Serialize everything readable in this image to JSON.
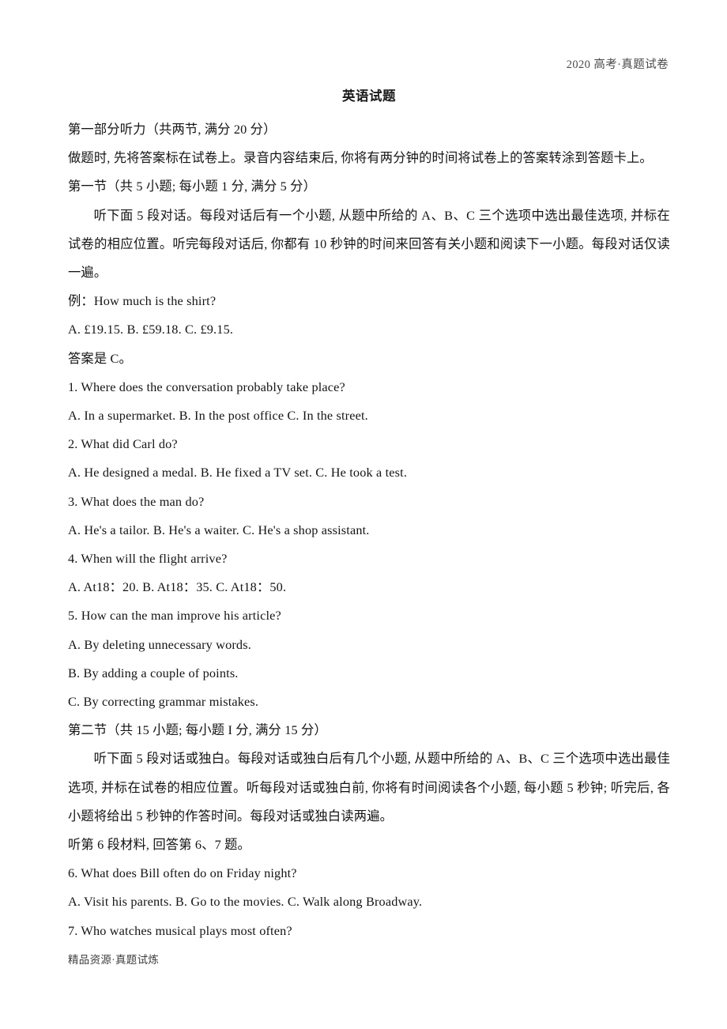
{
  "header": {
    "running_head": "2020 高考·真题试卷"
  },
  "paper": {
    "title": "英语试题"
  },
  "section_one": {
    "heading": "第一部分听力（共两节, 满分 20 分）",
    "instruction": "做题时, 先将答案标在试卷上。录音内容结束后, 你将有两分钟的时间将试卷上的答案转涂到答题卡上。",
    "part_one_heading": "第一节（共 5 小题; 每小题 1 分, 满分 5 分）",
    "part_one_directions": "听下面 5 段对话。每段对话后有一个小题, 从题中所给的 A、B、C 三个选项中选出最佳选项, 并标在试卷的相应位置。听完每段对话后, 你都有 10 秒钟的时间来回答有关小题和阅读下一小题。每段对话仅读一遍。",
    "example": {
      "stem": "例：How much is the shirt?",
      "options": "A. £19.15.        B. £59.18.        C. £9.15.",
      "answer": "答案是 C。"
    },
    "questions": [
      {
        "stem": "1. Where does the conversation probably take place?",
        "options": "A. In a supermarket.        B. In the post office        C. In the street."
      },
      {
        "stem": "2. What did Carl do?",
        "options": "A. He designed a medal.        B. He fixed a TV set.        C. He took a test."
      },
      {
        "stem": "3. What does the man do?",
        "options": "A. He's a tailor.        B. He's a waiter.        C. He's a shop assistant."
      },
      {
        "stem": "4. When will the flight arrive?",
        "options": "A. At18：20.        B. At18：35.        C. At18：50."
      },
      {
        "stem": "5. How can the man improve his article?",
        "option_a": "A. By deleting unnecessary words.",
        "option_b": "B. By adding a couple of points.",
        "option_c": "C. By correcting grammar mistakes."
      }
    ]
  },
  "section_two": {
    "part_two_heading": "第二节（共 15 小题; 每小题 I 分, 满分 15 分）",
    "part_two_directions": "听下面 5 段对话或独白。每段对话或独白后有几个小题, 从题中所给的 A、B、C 三个选项中选出最佳选项, 并标在试卷的相应位置。听每段对话或独白前, 你将有时间阅读各个小题, 每小题 5 秒钟; 听完后, 各小题将给出 5 秒钟的作答时间。每段对话或独白读两遍。",
    "material_six_lead": "听第 6 段材料, 回答第 6、7 题。",
    "questions": [
      {
        "stem": "6. What does Bill often do on Friday night?",
        "options": "A. Visit his parents.        B. Go to the movies.        C. Walk along Broadway."
      },
      {
        "stem": "7. Who watches musical plays most often?"
      }
    ]
  },
  "footer": {
    "watermark": "精品资源·真题试炼"
  }
}
